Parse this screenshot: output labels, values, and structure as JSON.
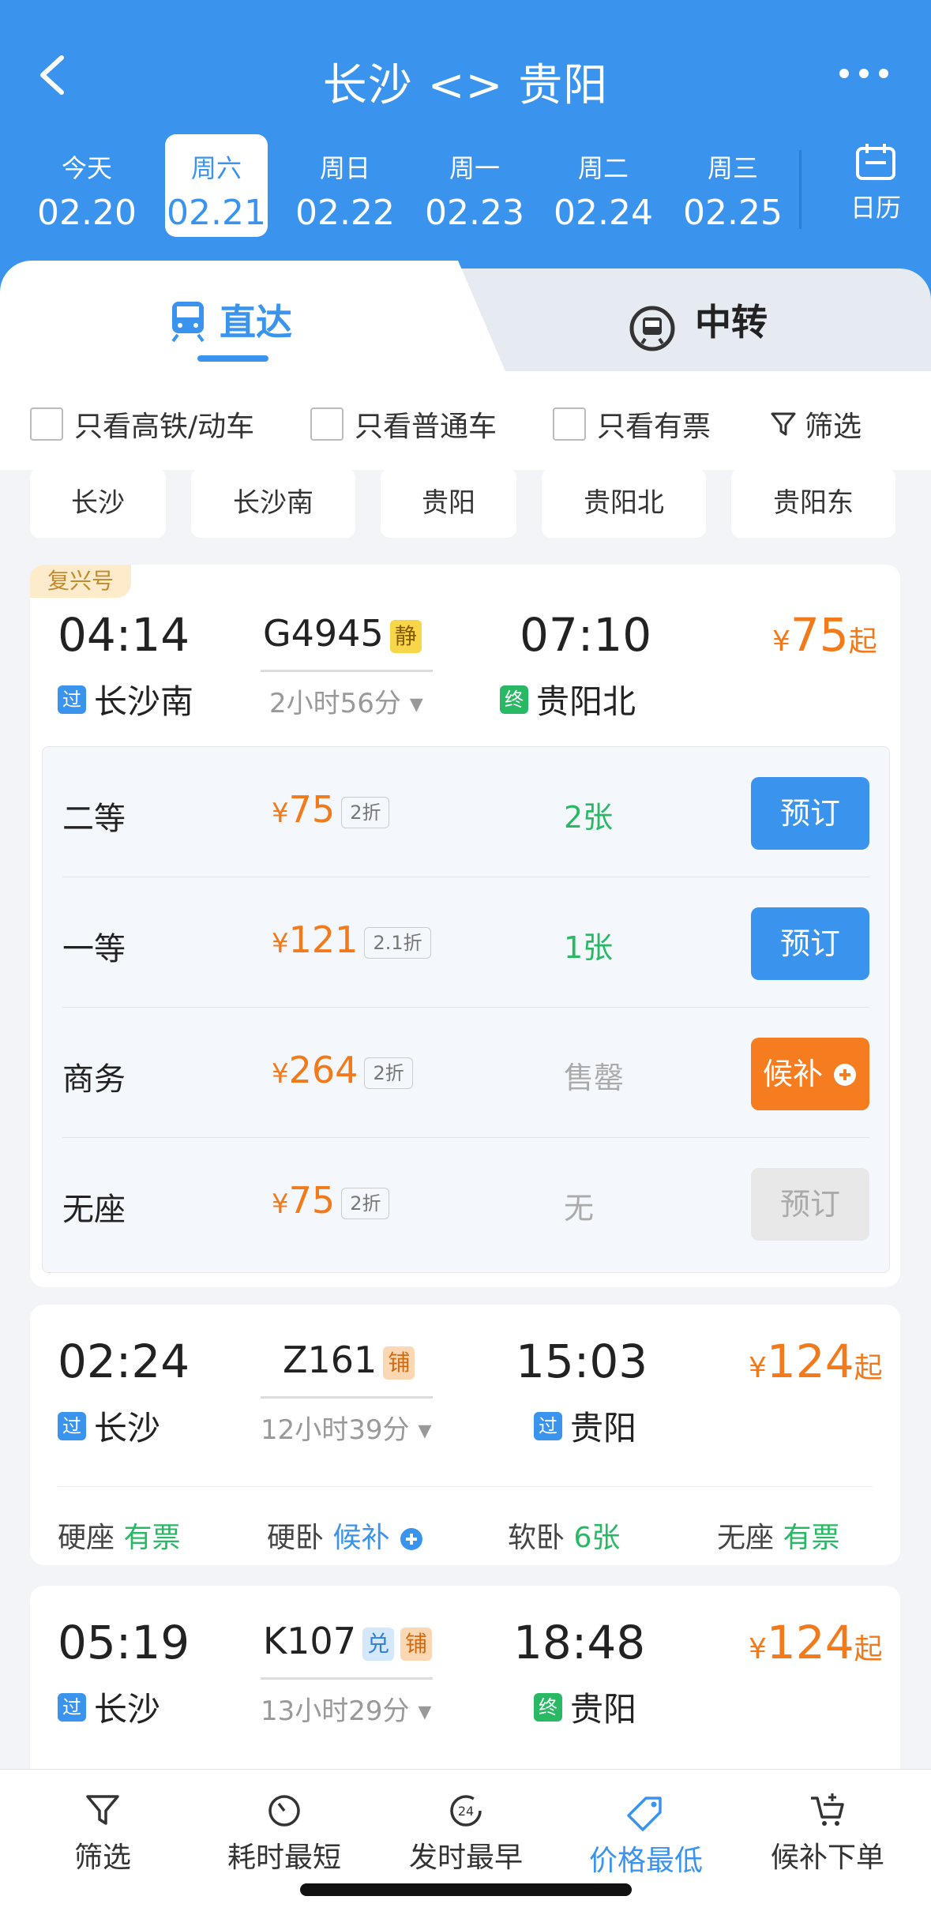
{
  "header": {
    "title": "长沙 <> 贵阳",
    "dates": [
      {
        "weekday": "今天",
        "date": "02.20"
      },
      {
        "weekday": "周六",
        "date": "02.21",
        "active": true
      },
      {
        "weekday": "周日",
        "date": "02.22"
      },
      {
        "weekday": "周一",
        "date": "02.23"
      },
      {
        "weekday": "周二",
        "date": "02.24"
      },
      {
        "weekday": "周三",
        "date": "02.25"
      }
    ],
    "calendar_label": "日历"
  },
  "tabs": {
    "direct": "直达",
    "transfer": "中转"
  },
  "filters": {
    "gaotie": "只看高铁/动车",
    "putong": "只看普通车",
    "youpiao": "只看有票",
    "shaixuan": "筛选"
  },
  "stations": [
    "长沙",
    "长沙南",
    "贵阳",
    "贵阳北",
    "贵阳东"
  ],
  "trains": [
    {
      "brand": "复兴号",
      "depart_time": "04:14",
      "arrive_time": "07:10",
      "train_no": "G4945",
      "tag1": "静",
      "duration": "2小时56分",
      "from_icon": "过",
      "from_station": "长沙南",
      "to_icon": "终",
      "to_station": "贵阳北",
      "price": "75",
      "price_suffix": "起",
      "seats": [
        {
          "name": "二等",
          "price": "75",
          "discount": "2折",
          "left": "2张",
          "button": "预订"
        },
        {
          "name": "一等",
          "price": "121",
          "discount": "2.1折",
          "left": "1张",
          "button": "预订"
        },
        {
          "name": "商务",
          "price": "264",
          "discount": "2折",
          "left": "售罄",
          "button": "候补"
        },
        {
          "name": "无座",
          "price": "75",
          "discount": "2折",
          "left": "无",
          "button": "预订"
        }
      ]
    },
    {
      "depart_time": "02:24",
      "arrive_time": "15:03",
      "train_no": "Z161",
      "tag1": "铺",
      "duration": "12小时39分",
      "from_icon": "过",
      "from_station": "长沙",
      "to_icon": "过",
      "to_station": "贵阳",
      "price": "124",
      "price_suffix": "起",
      "seats": [
        {
          "name": "硬座",
          "status": "有票"
        },
        {
          "name": "硬卧",
          "status": "候补"
        },
        {
          "name": "软卧",
          "status": "6张"
        },
        {
          "name": "无座",
          "status": "有票"
        }
      ]
    },
    {
      "depart_time": "05:19",
      "arrive_time": "18:48",
      "train_no": "K107",
      "tag1": "兑",
      "tag2": "铺",
      "duration": "13小时29分",
      "from_icon": "过",
      "from_station": "长沙",
      "to_icon": "终",
      "to_station": "贵阳",
      "price": "124",
      "price_suffix": "起"
    }
  ],
  "bottom_bar": [
    "筛选",
    "耗时最短",
    "发时最早",
    "价格最低",
    "候补下单"
  ],
  "icon_texts": {
    "clock24": "24"
  },
  "currency": "¥",
  "colors": {
    "primary": "#3a94ee",
    "orange": "#f27a1b",
    "green": "#29b864"
  }
}
